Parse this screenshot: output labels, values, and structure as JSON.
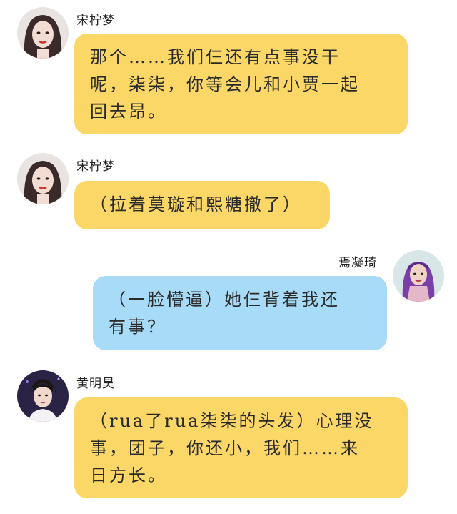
{
  "messages": [
    {
      "sender": "宋柠梦",
      "lines": [
        "那个……我们仨还有点事没干",
        "呢，柒柒，你等会儿和小贾一起",
        "回去昂。"
      ]
    },
    {
      "sender": "宋柠梦",
      "lines": [
        "（拉着莫璇和熙糖撤了）"
      ]
    },
    {
      "sender": "焉凝琦",
      "lines": [
        "（一脸懵逼）她仨背着我还",
        "有事？"
      ]
    },
    {
      "sender": "黄明昊",
      "lines": [
        "（rua了rua柒柒的头发）心理没",
        "事，团子，你还小，我们……来",
        "日方长。"
      ]
    }
  ],
  "colors": {
    "bubble_yellow": "#fbd768",
    "bubble_blue": "#a7dbf7"
  }
}
